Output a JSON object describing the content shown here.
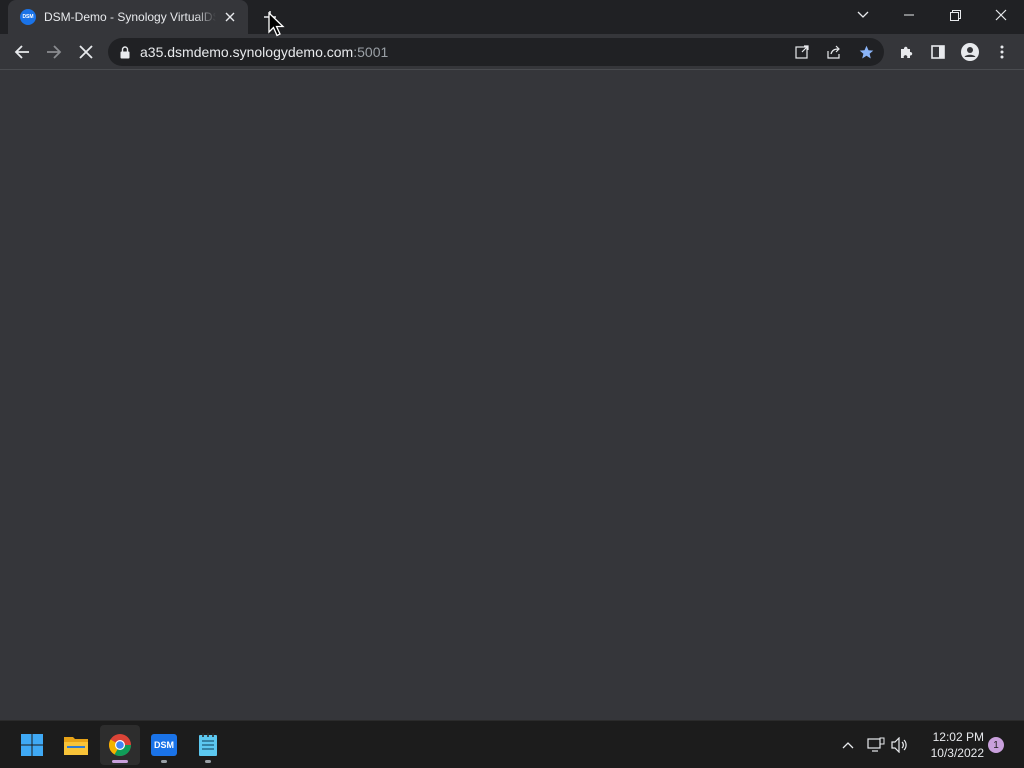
{
  "browser": {
    "tab": {
      "title": "DSM-Demo - Synology VirtualDSM",
      "favicon_text": "DSM",
      "favicon_color": "#1a73e8"
    },
    "address": {
      "host": "a35.dsmdemo.synologydemo.com",
      "port": ":5001"
    },
    "bookmark_star_color": "#8ab4f8",
    "loading": true
  },
  "icons": {
    "back": "back-arrow-icon",
    "forward": "forward-arrow-icon",
    "stop": "stop-loading-icon",
    "lock": "lock-icon",
    "open_in_app": "open-in-app-icon",
    "share": "share-icon",
    "bookmark": "star-icon",
    "extensions": "puzzle-icon",
    "side_panel": "side-panel-icon",
    "profile": "profile-icon",
    "menu": "kebab-menu-icon"
  },
  "taskbar": {
    "apps": [
      {
        "name": "Start",
        "icon": "windows-start-icon"
      },
      {
        "name": "File Explorer",
        "icon": "folder-icon"
      },
      {
        "name": "Google Chrome",
        "icon": "chrome-icon",
        "active": true
      },
      {
        "name": "DSM",
        "icon": "dsm-icon",
        "label": "DSM"
      },
      {
        "name": "Notepad",
        "icon": "notepad-icon"
      }
    ],
    "clock": {
      "time": "12:02 PM",
      "date": "10/3/2022"
    },
    "notification_count": "1"
  }
}
